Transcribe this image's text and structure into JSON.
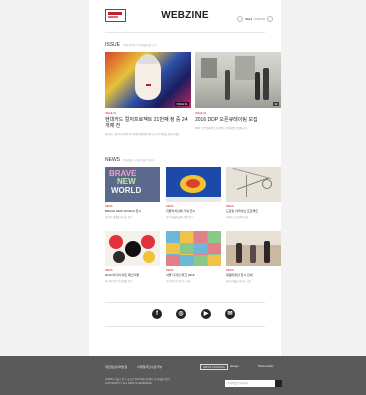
{
  "header": {
    "title": "WEBZINE",
    "volume": "Vol.1",
    "volume_sub": "2016.06"
  },
  "issue": {
    "heading": "ISSUE",
    "subheading": "아름다운재단 문화예술사업 소식",
    "cards": [
      {
        "category": "ISSUE 01",
        "title": "현대카드 컬처프로젝트 21번째 정 중 24개예 전",
        "desc": "현대카드 컬처프로젝트 21 번째 세계적인 아티스트의 작품을 만나보세요.",
        "tag": "ISSUE 01"
      },
      {
        "category": "ISSUE 02",
        "title": "2016 DDP 오픈큐레이팅 모집",
        "desc": "DDP 오픈큐레이팅 프로젝트 참가자를 모집합니다.",
        "tag": "02"
      }
    ]
  },
  "news": {
    "heading": "NEWS",
    "subheading": "문화예술 소식을 전해드립니다",
    "cards": [
      {
        "category": "NEWS",
        "title": "BRAVE NEW WORLD 전시",
        "desc": "새로운 세계를 만나는 전시"
      },
      {
        "category": "NEWS",
        "title": "지방자치단체 기획 전시",
        "desc": "지역 예술가들의 작품 전시"
      },
      {
        "category": "NEWS",
        "title": "드로잉 아카이브 프로젝트",
        "desc": "기록과 드로잉의 만남"
      },
      {
        "category": "NEWS",
        "title": "2016 미디어 아트 페스티벌",
        "desc": "미디어 아트의 현재를 보다"
      },
      {
        "category": "NEWS",
        "title": "서울 디자인 위크 2016",
        "desc": "디자인으로 만나는 서울"
      },
      {
        "category": "NEWS",
        "title": "대림미술관 전시 안내",
        "desc": "현대 미술을 만나는 시간"
      }
    ]
  },
  "social": [
    {
      "icon": "facebook-icon",
      "glyph": "f"
    },
    {
      "icon": "instagram-icon",
      "glyph": "◎"
    },
    {
      "icon": "youtube-icon",
      "glyph": "▶"
    },
    {
      "icon": "blog-icon",
      "glyph": "✉"
    }
  ],
  "footer": {
    "links": [
      "개인정보처리방침",
      "이메일무단수집거부"
    ],
    "info_line1": "(04536) 서울시 중구 을지로 100 아름다운재단 문화예술사업부",
    "info_line2": "COPYRIGHT © ALL RIGHTS RESERVED.",
    "logo1": "ARTS COUNCIL",
    "logo2": "design",
    "logo3": "Partnership",
    "search_placeholder": "검색어를 입력하세요"
  },
  "colors": {
    "accent": "#c8202a",
    "footer_bg": "#5a5a5a",
    "page_bg": "#f2f2f2"
  }
}
